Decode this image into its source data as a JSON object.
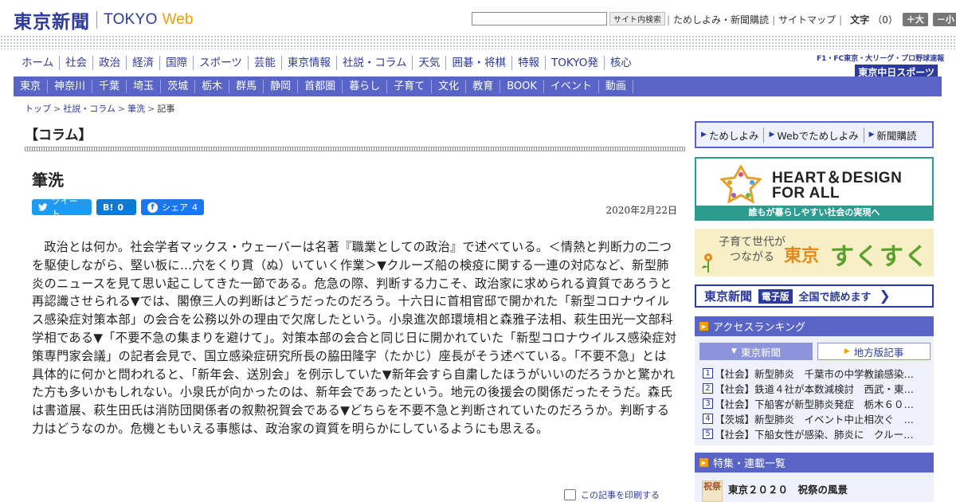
{
  "header": {
    "logo_jp": "東京新聞",
    "logo_tokyo": "TOKYO",
    "logo_web": "Web",
    "search_button": "サイト内検索",
    "link_trial": "ためしよみ・新聞購読",
    "link_sitemap": "サイトマップ",
    "font_label": "文字",
    "font_count": "（0）",
    "font_large": "＋大",
    "font_small": "－小"
  },
  "main_nav": [
    "ホーム",
    "社会",
    "政治",
    "経済",
    "国際",
    "スポーツ",
    "芸能",
    "東京情報",
    "社説・コラム",
    "天気",
    "囲碁・将棋",
    "特報",
    "TOKYO発",
    "核心"
  ],
  "chunichi": {
    "top": "F1・FC東京・大リーグ・プロ野球速報",
    "main": "東京中日スポーツ"
  },
  "sub_nav": [
    "東京",
    "神奈川",
    "千葉",
    "埼玉",
    "茨城",
    "栃木",
    "群馬",
    "静岡",
    "首都圏",
    "暮らし",
    "子育て",
    "文化",
    "教育",
    "BOOK",
    "イベント",
    "動画"
  ],
  "breadcrumb": [
    "トップ",
    "社説・コラム",
    "筆洗",
    "記事"
  ],
  "article": {
    "section": "【コラム】",
    "title": "筆洗",
    "tweet": "ツイート",
    "hatena_label": "B!",
    "hatena_count": "0",
    "fb_label": "シェア",
    "fb_count": "4",
    "date": "2020年2月22日",
    "body": "政治とは何か。社会学者マックス・ウェーバーは名著『職業としての政治』で述べている。＜情熱と判断力の二つを駆使しながら、堅い板に…穴をくり貫（ぬ）いていく作業＞▼クルーズ船の検疫に関する一連の対応など、新型肺炎のニュースを見て思い起こしてきた一節である。危急の際、判断する力こそ、政治家に求められる資質であろうと再認識させられる▼では、閣僚三人の判断はどうだったのだろう。十六日に首相官邸で開かれた「新型コロナウイルス感染症対策本部」の会合を公務以外の理由で欠席したという。小泉進次郎環境相と森雅子法相、萩生田光一文部科学相である▼「不要不急の集まりを避けて」。対策本部の会合と同じ日に開かれていた「新型コロナウイルス感染症対策専門家会議」の記者会見で、国立感染症研究所長の脇田隆字（たかじ）座長がそう述べている。「不要不急」とは具体的に何かと問われると、「新年会、送別会」を例示していた▼新年会すら自粛したほうがいいのだろうかと驚かれた方も多いかもしれない。小泉氏が向かったのは、新年会であったという。地元の後援会の関係だったそうだ。森氏は書道展、萩生田氏は消防団関係者の叙勲祝賀会である▼どちらを不要不急と判断されていたのだろうか。判断する力はどうなのか。危機ともいえる事態は、政治家の資質を明らかにしているようにも思える。",
    "print": "この記事を印刷する"
  },
  "sidebar": {
    "links": [
      "ためしよみ",
      "Webでためしよみ",
      "新聞購読"
    ],
    "hd_line1": "HEART＆DESIGN",
    "hd_line2": "FOR ALL",
    "hd_foot": "誰もが暮らしやすい社会の実現へ",
    "suku_small1": "子育て世代が",
    "suku_small2": "つながる",
    "suku_tokyo": "東京",
    "suku_main": "すくすく",
    "denshi_logo": "東京新聞",
    "denshi_tag": "電子版",
    "denshi_text": "全国で読めます",
    "ranking_title": "アクセスランキング",
    "tab_tokyo": "東京新聞",
    "tab_chiho": "地方版記事",
    "ranking": [
      {
        "num": "1",
        "text": "【社会】新型肺炎　千葉市の中学教諭感染…"
      },
      {
        "num": "2",
        "text": "【社会】鉄道４社が本数減検討　西武・東…"
      },
      {
        "num": "3",
        "text": "【社会】下船客が新型肺炎発症　栃木６０…"
      },
      {
        "num": "4",
        "text": "【茨城】新型肺炎　イベント中止相次ぐ　…"
      },
      {
        "num": "5",
        "text": "【社会】下船女性が感染、肺炎に　クルー…"
      }
    ],
    "feature_title": "特集・連載一覧",
    "feature_item": "東京２０２０　祝祭の風景",
    "feature_thumb": "祝祭"
  },
  "colors": {
    "brand_blue": "#2c3a9a",
    "nav_bar": "#5865c7",
    "accent_orange": "#f0a000",
    "hd_green": "#2d9b8d"
  }
}
